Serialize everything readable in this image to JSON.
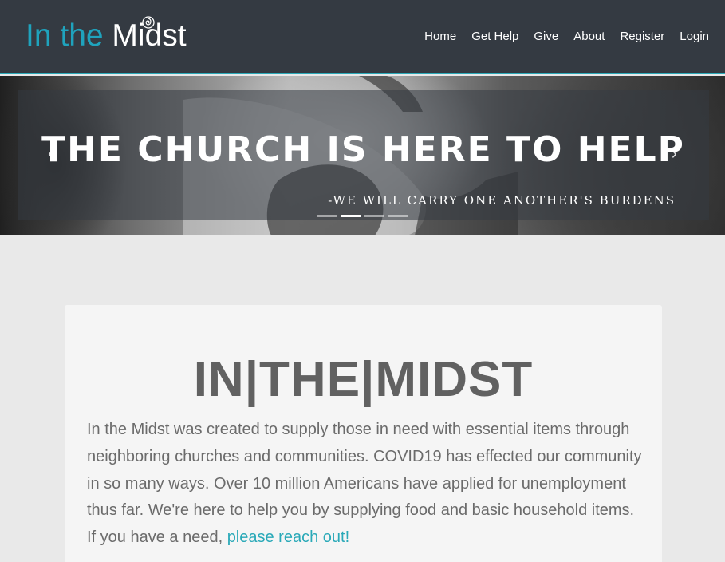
{
  "brand": {
    "part1": "In the ",
    "part2": "Midst"
  },
  "nav": {
    "items": [
      "Home",
      "Get Help",
      "Give",
      "About",
      "Register",
      "Login"
    ]
  },
  "hero": {
    "title": "THE CHURCH IS HERE TO HELP",
    "subtitle": "-WE WILL CARRY ONE ANOTHER'S BURDENS",
    "prev_icon": "chevron-left-icon",
    "next_icon": "chevron-right-icon",
    "slide_count": 4,
    "active_slide": 2
  },
  "content": {
    "title": "IN|THE|MIDST",
    "text": "In the Midst was created to supply those in need with essential items through neighboring churches and communities. COVID19 has effected our community in so many ways. Over 10 million Americans have applied for unemployment thus far. We're here to help you by supplying food and basic household items. If you have a need, ",
    "link": "please reach out!"
  },
  "colors": {
    "navbar": "#343a42",
    "accent": "#2aa9b8",
    "brand_teal": "#1fa3bd",
    "text": "#6b6b6b"
  }
}
